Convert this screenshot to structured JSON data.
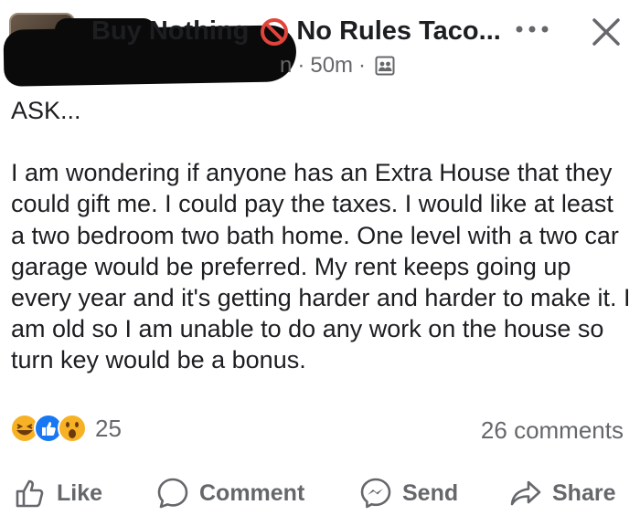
{
  "post": {
    "group_name_prefix": "Buy Nothing",
    "group_name_suffix": "No Rules Taco...",
    "partial_name_char": "n",
    "timestamp": "50m",
    "title": "ASK...",
    "body": "I am wondering if anyone has an Extra House that they could gift me. I could pay the taxes. I would like at least a two bedroom two bath home. One level with a two car garage would be preferred. My rent keeps going up every year and it's getting harder and harder to make it.  I am old so I am unable to do any work on the house so turn key would be a bonus."
  },
  "stats": {
    "reaction_icons": [
      "haha-icon",
      "like-icon",
      "wow-icon"
    ],
    "reaction_count": "25",
    "comments": "26 comments"
  },
  "actions": {
    "like": "Like",
    "comment": "Comment",
    "send": "Send",
    "share": "Share"
  },
  "colors": {
    "text": "#1c1e21",
    "secondary": "#65676b",
    "like_blue": "#1877f2",
    "reaction_yellow": "#f7b125",
    "prohibited_red": "#e0443a"
  }
}
